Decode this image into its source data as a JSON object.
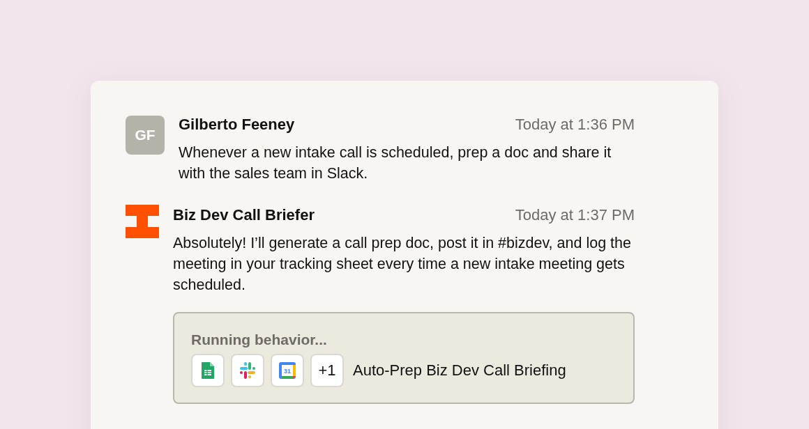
{
  "messages": [
    {
      "avatar": {
        "kind": "initials",
        "text": "GF"
      },
      "author": "Gilberto Feeney",
      "time": "Today at 1:36 PM",
      "text": "Whenever a new intake call is scheduled, prep a doc and share it with the sales team in Slack."
    },
    {
      "avatar": {
        "kind": "logo"
      },
      "author": "Biz Dev Call Briefer",
      "time": "Today at 1:37 PM",
      "text": "Absolutely! I’ll generate a call prep doc, post it in #bizdev, and log the meeting in your tracking sheet every time a new intake meeting gets scheduled.",
      "behavior": {
        "status": "Running behavior...",
        "apps": [
          {
            "kind": "sheets"
          },
          {
            "kind": "slack"
          },
          {
            "kind": "calendar",
            "text": "31"
          },
          {
            "kind": "more",
            "text": "+1"
          }
        ],
        "name": "Auto-Prep Biz Dev Call Briefing"
      }
    }
  ]
}
